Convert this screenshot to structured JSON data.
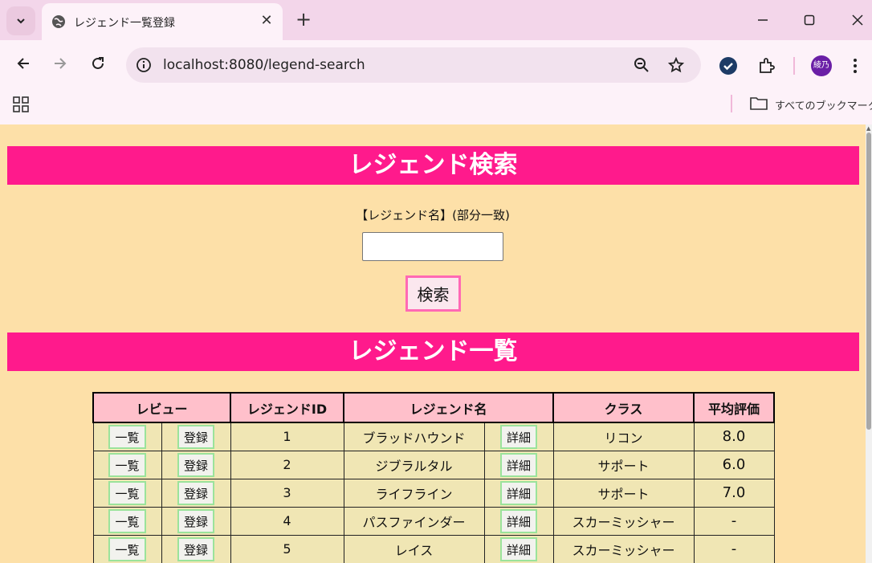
{
  "browser": {
    "tab_title": "レジェンド一覧登録",
    "url": "localhost:8080/legend-search",
    "avatar_text": "綾乃",
    "bookmarks_label": "すべてのブックマーク"
  },
  "page": {
    "search_heading": "レジェンド検索",
    "search_label": "【レジェンド名】(部分一致)",
    "search_input_value": "",
    "search_button": "検索",
    "list_heading": "レジェンド一覧"
  },
  "table": {
    "headers": {
      "review": "レビュー",
      "legend_id": "レジェンドID",
      "legend_name": "レジェンド名",
      "class": "クラス",
      "avg_rating": "平均評価"
    },
    "list_button": "一覧",
    "register_button": "登録",
    "detail_button": "詳細",
    "rows": [
      {
        "id": "1",
        "name": "ブラッドハウンド",
        "class": "リコン",
        "rating": "8.0"
      },
      {
        "id": "2",
        "name": "ジブラルタル",
        "class": "サポート",
        "rating": "6.0"
      },
      {
        "id": "3",
        "name": "ライフライン",
        "class": "サポート",
        "rating": "7.0"
      },
      {
        "id": "4",
        "name": "パスファインダー",
        "class": "スカーミッシャー",
        "rating": "-"
      },
      {
        "id": "5",
        "name": "レイス",
        "class": "スカーミッシャー",
        "rating": "-"
      }
    ]
  },
  "colors": {
    "page_bg": "#fde0a8",
    "heading_bg": "#ff1a8c",
    "table_header_bg": "#ffc0cb",
    "table_cell_bg": "#f0e6b4",
    "button_border": "#ff69b4"
  }
}
